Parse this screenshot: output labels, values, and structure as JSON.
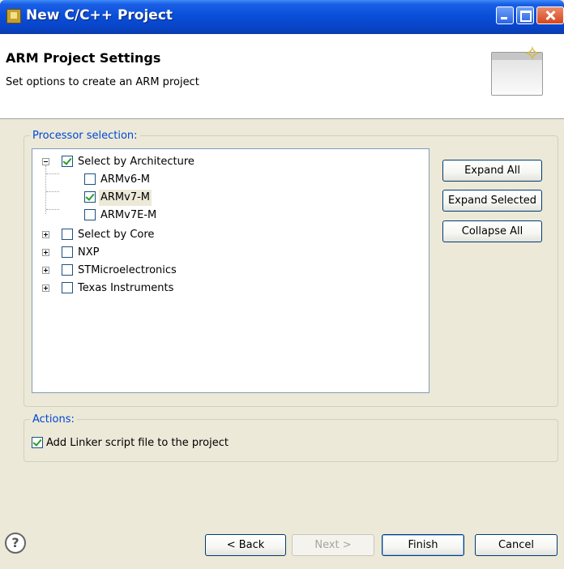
{
  "window": {
    "title": "New C/C++ Project"
  },
  "header": {
    "title": "ARM Project Settings",
    "description": "Set options to create an ARM project"
  },
  "processor_selection": {
    "legend": "Processor selection:",
    "tree": [
      {
        "label": "Select by Architecture",
        "checked": true,
        "expanded": true,
        "children": [
          {
            "label": "ARMv6-M",
            "checked": false
          },
          {
            "label": "ARMv7-M",
            "checked": true,
            "selected": true
          },
          {
            "label": "ARMv7E-M",
            "checked": false
          }
        ]
      },
      {
        "label": "Select by Core",
        "checked": false,
        "expanded": false
      },
      {
        "label": "NXP",
        "checked": false,
        "expanded": false
      },
      {
        "label": "STMicroelectronics",
        "checked": false,
        "expanded": false
      },
      {
        "label": "Texas Instruments",
        "checked": false,
        "expanded": false
      }
    ],
    "buttons": {
      "expand_all": "Expand All",
      "expand_selected": "Expand Selected",
      "collapse_all": "Collapse All"
    }
  },
  "actions": {
    "legend": "Actions:",
    "add_linker_script": {
      "label": "Add Linker script file to the project",
      "checked": true
    }
  },
  "footer": {
    "help_glyph": "?",
    "back": "< Back",
    "next": "Next >",
    "finish": "Finish",
    "cancel": "Cancel"
  },
  "colors": {
    "title_bar": "#0a4fd9",
    "legend_text": "#0046d5",
    "check_mark": "#21a121",
    "dialog_bg": "#ece9d8"
  }
}
